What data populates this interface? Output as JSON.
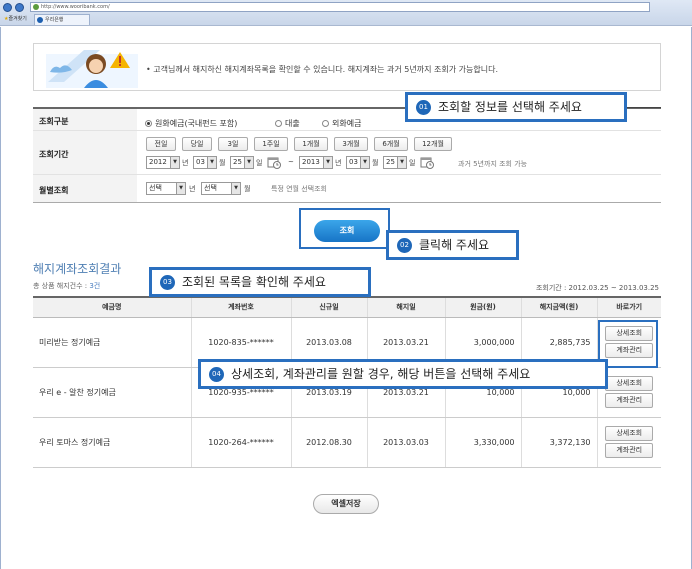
{
  "browser": {
    "url": "http://www.wooribank.com/",
    "favorites_label": "즐겨찾기",
    "tab_label": "우리은행"
  },
  "notice": {
    "text": "• 고객님께서 해지하신 해지계좌목록을 확인할 수 있습니다. 해지계좌는 과거 5년까지 조회가 가능합니다."
  },
  "form": {
    "type_label": "조회구분",
    "type_options": [
      "원화예금(국내펀드 포함)",
      "대출",
      "외화예금"
    ],
    "period_label": "조회기간",
    "period_buttons": [
      "전일",
      "당일",
      "3일",
      "1주일",
      "1개월",
      "3개월",
      "6개월",
      "12개월"
    ],
    "from": {
      "year": "2012",
      "month": "03",
      "day": "25"
    },
    "to": {
      "year": "2013",
      "month": "03",
      "day": "25"
    },
    "units": {
      "year": "년",
      "month": "월",
      "day": "일"
    },
    "tilde": "~",
    "period_hint": "과거 5년까지 조회 가능",
    "monthly_label": "월별조회",
    "monthly_year": "선택",
    "monthly_month": "선택",
    "monthly_hint": "특정 연월 선택조회",
    "search_button": "조회"
  },
  "result": {
    "title": "해지계좌조회결과",
    "count_prefix": "총 상품 해지건수 : ",
    "count_value": "3건",
    "period": "조회기간 : 2012.03.25 ~ 2013.03.25",
    "columns": [
      "예금명",
      "계좌번호",
      "신규일",
      "해지일",
      "원금(원)",
      "해지금액(원)",
      "바로가기"
    ],
    "rows": [
      {
        "name": "미리받는 정기예금",
        "account": "1020-835-******",
        "opened": "2013.03.08",
        "closed": "2013.03.21",
        "principal": "3,000,000",
        "amount": "2,885,735"
      },
      {
        "name": "우리 e - 알찬 정기예금",
        "account": "1020-935-******",
        "opened": "2013.03.19",
        "closed": "2013.03.21",
        "principal": "10,000",
        "amount": "10,000"
      },
      {
        "name": "우리 토마스 정기예금",
        "account": "1020-264-******",
        "opened": "2012.08.30",
        "closed": "2013.03.03",
        "principal": "3,330,000",
        "amount": "3,372,130"
      }
    ],
    "detail_button": "상세조회",
    "manage_button": "계좌관리",
    "excel_button": "엑셀저장"
  },
  "callouts": [
    {
      "num": "01",
      "text": "조회할 정보를 선택해 주세요"
    },
    {
      "num": "02",
      "text": "클릭해 주세요"
    },
    {
      "num": "03",
      "text": "조회된 목록을 확인해 주세요"
    },
    {
      "num": "04",
      "text": "상세조회, 계좌관리를 원할 경우, 해당 버튼을 선택해 주세요"
    }
  ],
  "colors": {
    "accent": "#2a6fbf",
    "button_blue": "#1f7ed0",
    "title_blue": "#4f7fb3"
  }
}
